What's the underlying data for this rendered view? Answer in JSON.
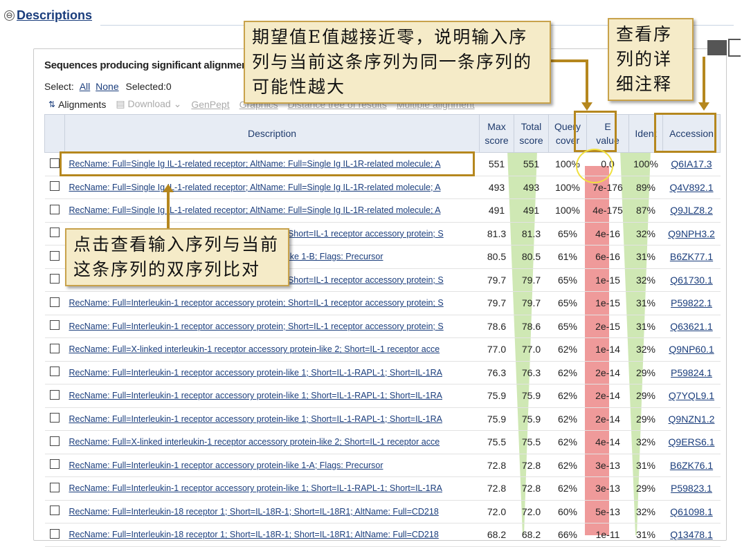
{
  "section": {
    "toggle": "⊖",
    "title": "Descriptions"
  },
  "panel_title": "Sequences producing significant alignments:",
  "select": {
    "label": "Select:",
    "all": "All",
    "none": "None",
    "selected": "Selected:0"
  },
  "toolbar": {
    "alignments": "Alignments",
    "download": "Download",
    "genpept": "GenPept",
    "graphics": "Graphics",
    "tree": "Distance tree of results",
    "multiple": "Multiple alignment"
  },
  "columns": {
    "description": "Description",
    "max_score": [
      "Max",
      "score"
    ],
    "total_score": [
      "Total",
      "score"
    ],
    "query_cover": [
      "Query",
      "cover"
    ],
    "e_value": [
      "E",
      "value"
    ],
    "ident": "Ident",
    "accession": "Accession"
  },
  "rows": [
    {
      "desc": "RecName: Full=Single Ig IL-1-related receptor; AltName: Full=Single Ig IL-1R-related molecule; A",
      "max": "551",
      "total": "551",
      "cover": "100%",
      "e": "0.0",
      "ident": "100%",
      "acc": "Q6IA17.3"
    },
    {
      "desc": "RecName: Full=Single Ig IL-1-related receptor; AltName: Full=Single Ig IL-1R-related molecule; A",
      "max": "493",
      "total": "493",
      "cover": "100%",
      "e": "7e-176",
      "ident": "89%",
      "acc": "Q4V892.1"
    },
    {
      "desc": "RecName: Full=Single Ig IL-1-related receptor; AltName: Full=Single Ig IL-1R-related molecule; A",
      "max": "491",
      "total": "491",
      "cover": "100%",
      "e": "4e-175",
      "ident": "87%",
      "acc": "Q9JLZ8.2"
    },
    {
      "desc": "RecName: Full=Interleukin-1 receptor accessory protein; Short=IL-1 receptor accessory protein; S",
      "max": "81.3",
      "total": "81.3",
      "cover": "65%",
      "e": "4e-16",
      "ident": "32%",
      "acc": "Q9NPH3.2"
    },
    {
      "desc": "RecName: Full=Interleukin-1 receptor accessory protein-like 1-B; Flags: Precursor",
      "max": "80.5",
      "total": "80.5",
      "cover": "61%",
      "e": "6e-16",
      "ident": "31%",
      "acc": "B6ZK77.1"
    },
    {
      "desc": "RecName: Full=Interleukin-1 receptor accessory protein; Short=IL-1 receptor accessory protein; S",
      "max": "79.7",
      "total": "79.7",
      "cover": "65%",
      "e": "1e-15",
      "ident": "32%",
      "acc": "Q61730.1"
    },
    {
      "desc": "RecName: Full=Interleukin-1 receptor accessory protein; Short=IL-1 receptor accessory protein; S",
      "max": "79.7",
      "total": "79.7",
      "cover": "65%",
      "e": "1e-15",
      "ident": "31%",
      "acc": "P59822.1"
    },
    {
      "desc": "RecName: Full=Interleukin-1 receptor accessory protein; Short=IL-1 receptor accessory protein; S",
      "max": "78.6",
      "total": "78.6",
      "cover": "65%",
      "e": "2e-15",
      "ident": "31%",
      "acc": "Q63621.1"
    },
    {
      "desc": "RecName: Full=X-linked interleukin-1 receptor accessory protein-like 2; Short=IL-1 receptor acce",
      "max": "77.0",
      "total": "77.0",
      "cover": "62%",
      "e": "1e-14",
      "ident": "32%",
      "acc": "Q9NP60.1"
    },
    {
      "desc": "RecName: Full=Interleukin-1 receptor accessory protein-like 1; Short=IL-1-RAPL-1; Short=IL-1RA",
      "max": "76.3",
      "total": "76.3",
      "cover": "62%",
      "e": "2e-14",
      "ident": "29%",
      "acc": "P59824.1"
    },
    {
      "desc": "RecName: Full=Interleukin-1 receptor accessory protein-like 1; Short=IL-1-RAPL-1; Short=IL-1RA",
      "max": "75.9",
      "total": "75.9",
      "cover": "62%",
      "e": "2e-14",
      "ident": "29%",
      "acc": "Q7YQL9.1"
    },
    {
      "desc": "RecName: Full=Interleukin-1 receptor accessory protein-like 1; Short=IL-1-RAPL-1; Short=IL-1RA",
      "max": "75.9",
      "total": "75.9",
      "cover": "62%",
      "e": "2e-14",
      "ident": "29%",
      "acc": "Q9NZN1.2"
    },
    {
      "desc": "RecName: Full=X-linked interleukin-1 receptor accessory protein-like 2; Short=IL-1 receptor acce",
      "max": "75.5",
      "total": "75.5",
      "cover": "62%",
      "e": "4e-14",
      "ident": "32%",
      "acc": "Q9ERS6.1"
    },
    {
      "desc": "RecName: Full=Interleukin-1 receptor accessory protein-like 1-A; Flags: Precursor",
      "max": "72.8",
      "total": "72.8",
      "cover": "62%",
      "e": "3e-13",
      "ident": "31%",
      "acc": "B6ZK76.1"
    },
    {
      "desc": "RecName: Full=Interleukin-1 receptor accessory protein-like 1; Short=IL-1-RAPL-1; Short=IL-1RA",
      "max": "72.8",
      "total": "72.8",
      "cover": "62%",
      "e": "3e-13",
      "ident": "29%",
      "acc": "P59823.1"
    },
    {
      "desc": "RecName: Full=Interleukin-18 receptor 1; Short=IL-18R-1; Short=IL-18R1; AltName: Full=CD218",
      "max": "72.0",
      "total": "72.0",
      "cover": "60%",
      "e": "5e-13",
      "ident": "32%",
      "acc": "Q61098.1"
    },
    {
      "desc": "RecName: Full=Interleukin-18 receptor 1; Short=IL-18R-1; Short=IL-18R1; AltName: Full=CD218",
      "max": "68.2",
      "total": "68.2",
      "cover": "66%",
      "e": "1e-11",
      "ident": "31%",
      "acc": "Q13478.1"
    }
  ],
  "annotations": {
    "evalue_note": "期望值E值越接近零，说明输入序列与当前这条序列为同一条序列的可能性越大",
    "accession_note": "查看序列的详细注释",
    "alignment_note": "点击查看输入序列与当前这条序列的双序列比对"
  },
  "colors": {
    "annotation_bg": "#f5ebc8",
    "annotation_border": "#b5871e",
    "link": "#1a3d7c",
    "header_bg": "#e7ecf4",
    "total_score_fill": "#c8e6a8",
    "ident_fill": "#c8e6a8",
    "evalue_fill": "#ef8e8e"
  }
}
